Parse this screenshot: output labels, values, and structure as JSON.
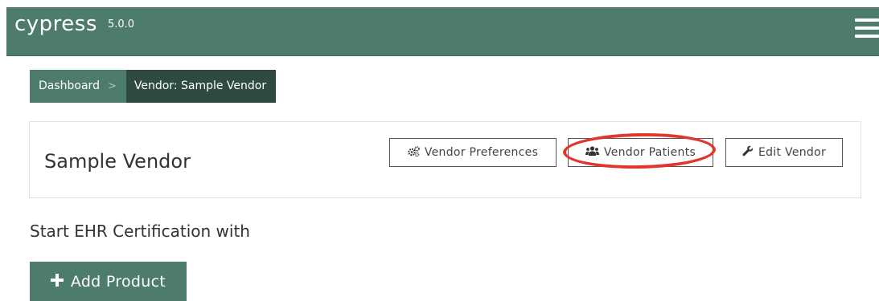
{
  "app": {
    "brand": "cypress",
    "version": "5.0.0"
  },
  "breadcrumb": {
    "items": [
      {
        "label": "Dashboard"
      },
      {
        "label": "Vendor: Sample Vendor"
      }
    ],
    "separator": ">"
  },
  "vendor": {
    "name": "Sample Vendor",
    "buttons": {
      "preferences": {
        "label": "Vendor Preferences",
        "icon": "gears-icon"
      },
      "patients": {
        "label": "Vendor Patients",
        "icon": "users-icon"
      },
      "edit": {
        "label": "Edit Vendor",
        "icon": "wrench-icon"
      }
    }
  },
  "certification": {
    "heading": "Start EHR Certification with",
    "add_product_label": "Add Product",
    "add_product_icon": "plus-icon"
  },
  "colors": {
    "brand_green": "#4d7b6e",
    "dark_green": "#2f4a43",
    "highlight_red": "#e2362c"
  }
}
